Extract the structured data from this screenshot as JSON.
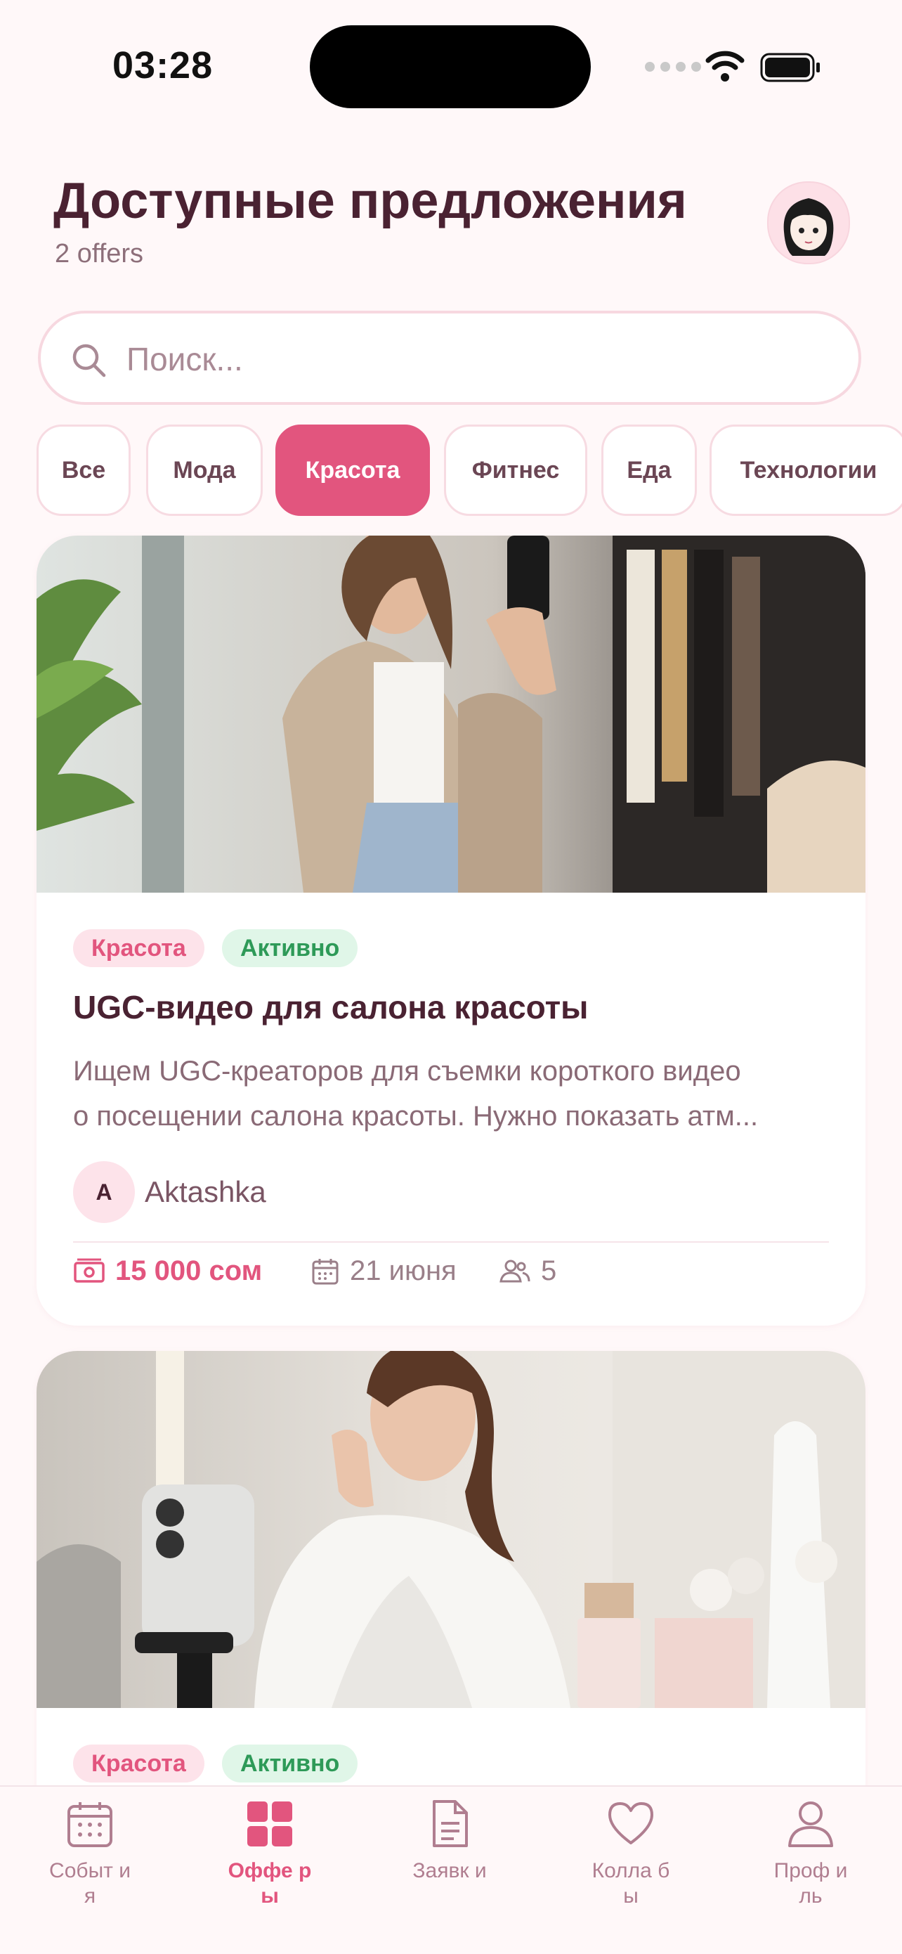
{
  "status_bar": {
    "time": "03:28"
  },
  "header": {
    "title": "Доступные предложения",
    "subtitle": "2 offers"
  },
  "search": {
    "placeholder": "Поиск..."
  },
  "categories": [
    {
      "label": "Все",
      "active": false
    },
    {
      "label": "Мода",
      "active": false
    },
    {
      "label": "Красота",
      "active": true
    },
    {
      "label": "Фитнес",
      "active": false
    },
    {
      "label": "Еда",
      "active": false
    },
    {
      "label": "Технологии",
      "active": false
    }
  ],
  "offers": [
    {
      "category": "Красота",
      "status": "Активно",
      "title": "UGC-видео для салона красоты",
      "description_line1": "Ищем UGC-креаторов для съемки короткого видео",
      "description_line2": "о посещении салона красоты. Нужно показать атм...",
      "author_initial": "A",
      "author": "Aktashka",
      "price": "15 000 сом",
      "date": "21 июня",
      "participants": "5"
    },
    {
      "category": "Красота",
      "status": "Активно"
    }
  ],
  "tabbar": [
    {
      "label": "Событ ия",
      "icon": "calendar-icon",
      "active": false
    },
    {
      "label": "Оффе ры",
      "icon": "grid-icon",
      "active": true
    },
    {
      "label": "Заявк и",
      "icon": "document-icon",
      "active": false
    },
    {
      "label": "Колла бы",
      "icon": "heart-icon",
      "active": false
    },
    {
      "label": "Проф иль",
      "icon": "user-icon",
      "active": false
    }
  ],
  "colors": {
    "accent": "#e2557e",
    "background": "#fff8f9",
    "status_active": "#2e9a58"
  }
}
